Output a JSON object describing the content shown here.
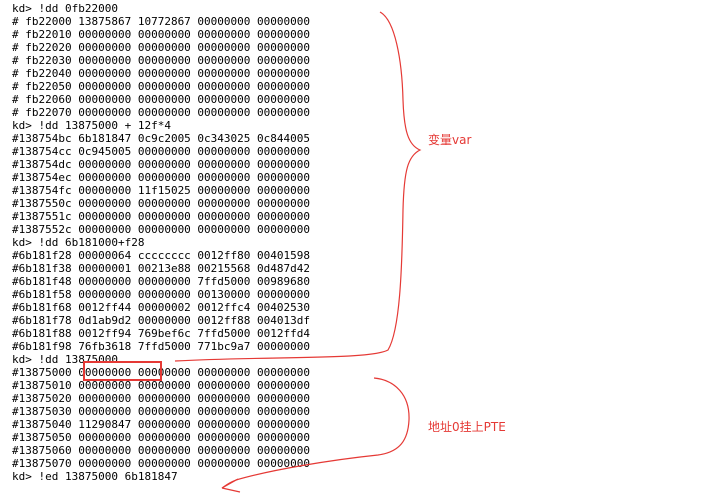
{
  "console": {
    "lines": [
      "kd> !dd 0fb22000",
      "# fb22000 13875867 10772867 00000000 00000000",
      "# fb22010 00000000 00000000 00000000 00000000",
      "# fb22020 00000000 00000000 00000000 00000000",
      "# fb22030 00000000 00000000 00000000 00000000",
      "# fb22040 00000000 00000000 00000000 00000000",
      "# fb22050 00000000 00000000 00000000 00000000",
      "# fb22060 00000000 00000000 00000000 00000000",
      "# fb22070 00000000 00000000 00000000 00000000",
      "kd> !dd 13875000 + 12f*4",
      "#138754bc 6b181847 0c9c2005 0c343025 0c844005",
      "#138754cc 0c945005 00000000 00000000 00000000",
      "#138754dc 00000000 00000000 00000000 00000000",
      "#138754ec 00000000 00000000 00000000 00000000",
      "#138754fc 00000000 11f15025 00000000 00000000",
      "#1387550c 00000000 00000000 00000000 00000000",
      "#1387551c 00000000 00000000 00000000 00000000",
      "#1387552c 00000000 00000000 00000000 00000000",
      "kd> !dd 6b181000+f28",
      "#6b181f28 00000064 cccccccc 0012ff80 00401598",
      "#6b181f38 00000001 00213e88 00215568 0d487d42",
      "#6b181f48 00000000 00000000 7ffd5000 00989680",
      "#6b181f58 00000000 00000000 00130000 00000000",
      "#6b181f68 0012ff44 00000002 0012ffc4 00402530",
      "#6b181f78 0d1ab9d2 00000000 0012ff88 004013df",
      "#6b181f88 0012ff94 769bef6c 7ffd5000 0012ffd4",
      "#6b181f98 76fb3618 7ffd5000 771bc9a7 00000000",
      "kd> !dd 13875000",
      "#13875000 00000000 00000000 00000000 00000000",
      "#13875010 00000000 00000000 00000000 00000000",
      "#13875020 00000000 00000000 00000000 00000000",
      "#13875030 00000000 00000000 00000000 00000000",
      "#13875040 11290847 00000000 00000000 00000000",
      "#13875050 00000000 00000000 00000000 00000000",
      "#13875060 00000000 00000000 00000000 00000000",
      "#13875070 00000000 00000000 00000000 00000000",
      "kd> !ed 13875000 6b181847"
    ]
  },
  "annotations": {
    "var_label": "变量var",
    "pte_label": "地址0挂上PTE"
  },
  "colors": {
    "text": "#000000",
    "background": "#ffffff",
    "annotation": "#e53935"
  }
}
